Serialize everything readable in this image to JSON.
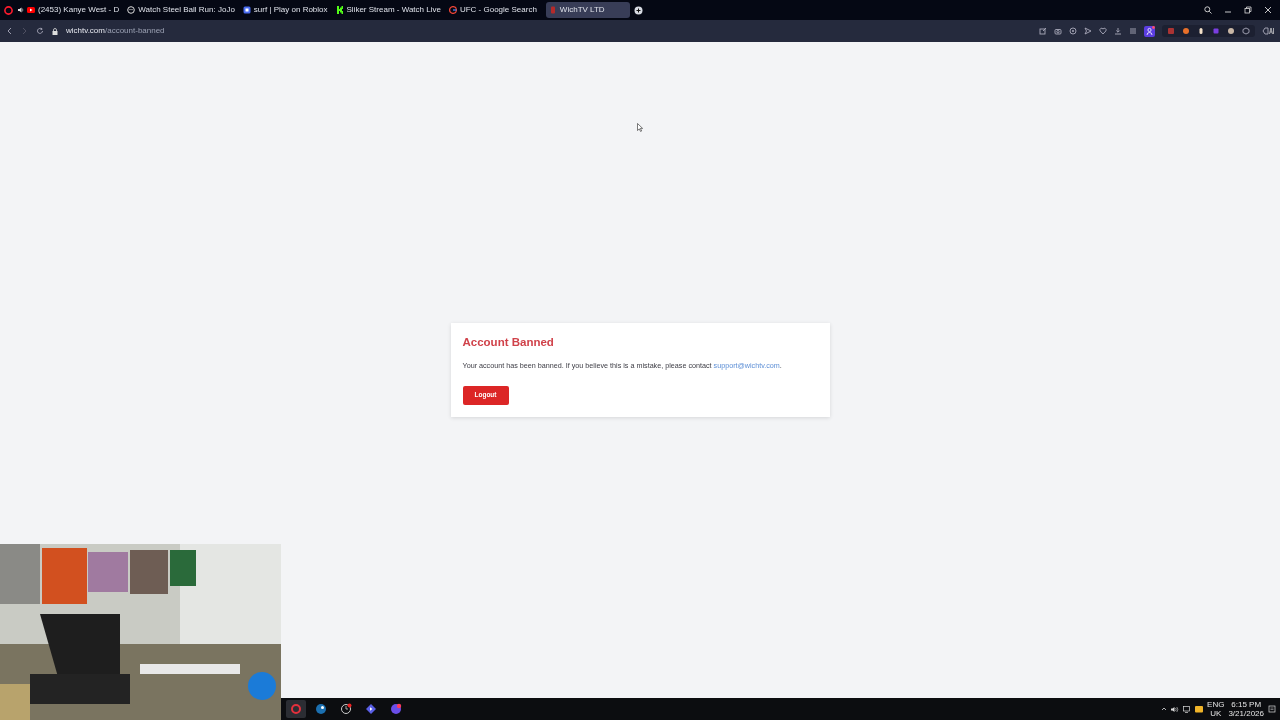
{
  "browser": {
    "tabs": [
      {
        "title": "(2453) Kanye West - D",
        "kind": "video",
        "audio": true,
        "selected": false
      },
      {
        "title": "Watch Steel Ball Run: JoJo",
        "kind": "mask",
        "audio": false,
        "selected": false
      },
      {
        "title": "surf | Play on Roblox",
        "kind": "block",
        "audio": false,
        "selected": false
      },
      {
        "title": "Sliker Stream - Watch Live",
        "kind": "kick",
        "audio": false,
        "selected": false
      },
      {
        "title": "UFC - Google Search",
        "kind": "google",
        "audio": false,
        "selected": false
      },
      {
        "title": "WichTV LTD",
        "kind": "site",
        "audio": false,
        "selected": true
      }
    ],
    "address": {
      "domain": "wichtv.com",
      "path": "/account-banned"
    }
  },
  "card": {
    "title": "Account Banned",
    "message": "Your account has been banned. If you believe this is a mistake, please contact",
    "link": "support@wichtv.com",
    "after_link": ".",
    "button": "Logout"
  },
  "taskbar": {
    "apps": [
      {
        "kind": "opera",
        "selected": true
      },
      {
        "kind": "steam",
        "selected": false
      },
      {
        "kind": "clock",
        "selected": false
      },
      {
        "kind": "play",
        "selected": false
      },
      {
        "kind": "chat",
        "selected": false
      }
    ],
    "language": "ENG",
    "region": "UK",
    "time": "6:15 PM",
    "date": "3/21/2026"
  }
}
